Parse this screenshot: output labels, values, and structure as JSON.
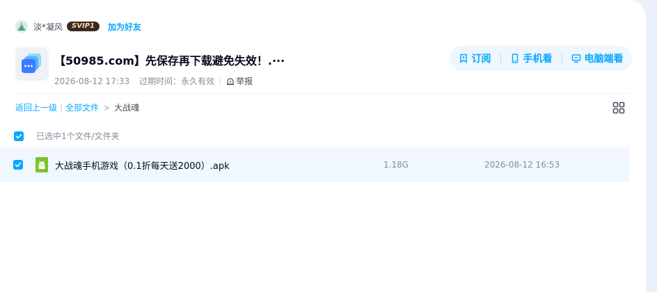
{
  "user": {
    "name": "淡*凝风",
    "vip_label": "SVIP1",
    "add_friend": "加为好友"
  },
  "share": {
    "title": "【50985.com】先保存再下载避免失效！.···",
    "date": "2026-08-12 17:33",
    "expire_label": "过期时间：",
    "expire_value": "永久有效",
    "report": "举报"
  },
  "actions": {
    "subscribe": "订阅",
    "mobile": "手机看",
    "desktop": "电脑端看"
  },
  "breadcrumb": {
    "back": "返回上一级",
    "all_files": "全部文件",
    "current": "大战魂",
    "separator": "|",
    "arrow": ">"
  },
  "selection": {
    "text": "已选中1个文件/文件夹"
  },
  "files": [
    {
      "name": "大战魂手机游戏（0.1折每天送2000）.apk",
      "size": "1.18G",
      "time": "2026-08-12 16:53",
      "icon": "android-apk-icon"
    }
  ],
  "colors": {
    "accent": "#06a7ff",
    "row_selected": "#f0f7ff",
    "apk_green": "#7cc22b"
  }
}
